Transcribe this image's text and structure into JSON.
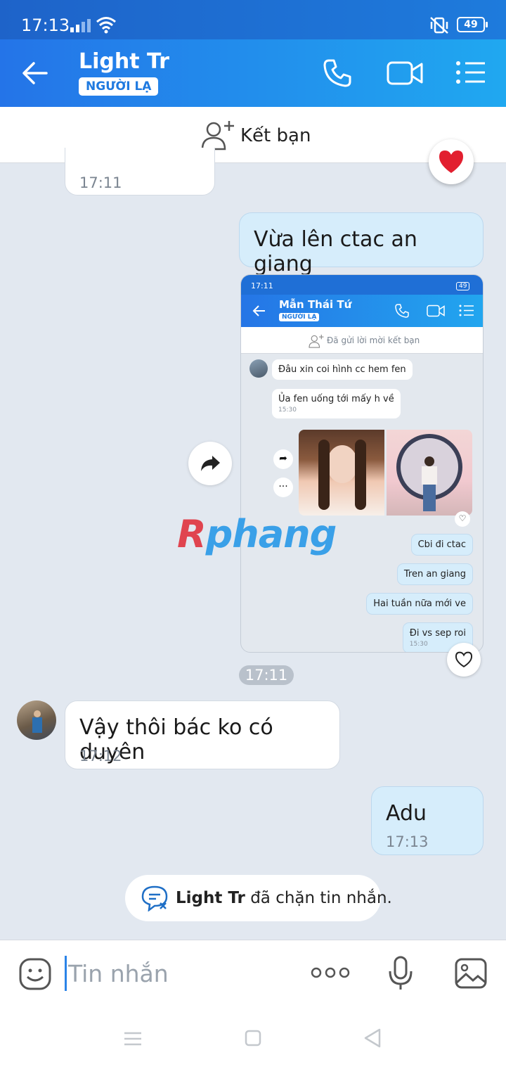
{
  "status_bar": {
    "time": "17:13",
    "battery": "49"
  },
  "header": {
    "name": "Light Tr",
    "tag": "NGƯỜI LẠ"
  },
  "friend_bar": {
    "label": "Kết bạn"
  },
  "messages": [
    {
      "id": "m0",
      "direction": "in",
      "text": "",
      "time": "17:11"
    },
    {
      "id": "m1",
      "direction": "out",
      "text": "Vừa lên ctac an giang"
    },
    {
      "id": "m2",
      "direction": "in",
      "text": "Vậy thôi bác ko có duyên",
      "time": "17:12"
    },
    {
      "id": "m3",
      "direction": "out",
      "text": "Adu",
      "time": "17:13"
    }
  ],
  "time_separator": "17:11",
  "embedded_screenshot": {
    "status_time": "17:11",
    "battery": "49",
    "name": "Mẫn Thái Tứ",
    "tag": "NGƯỜI LẠ",
    "friend_status": "Đã gửi lời mời kết bạn",
    "messages": [
      {
        "direction": "in",
        "text": "Đâu xin coi hình cc hem fen"
      },
      {
        "direction": "in",
        "text": "Ủa fen uống tới mấy h về",
        "time": "15:30"
      },
      {
        "direction": "out",
        "text": "Cbi đi ctac"
      },
      {
        "direction": "out",
        "text": "Tren an giang"
      },
      {
        "direction": "out",
        "text": "Hai tuần nữa mới ve"
      },
      {
        "direction": "out",
        "text": "Đi vs sep roi",
        "time": "15:30"
      }
    ]
  },
  "watermark": {
    "part1": "R",
    "part2": "phang"
  },
  "blocked_notice": {
    "name": "Light Tr",
    "text": " đã chặn tin nhắn."
  },
  "input": {
    "placeholder": "Tin nhắn"
  },
  "colors": {
    "header": "#2474e8",
    "accent": "#20a8f0",
    "out_bubble": "#d6edfb"
  }
}
